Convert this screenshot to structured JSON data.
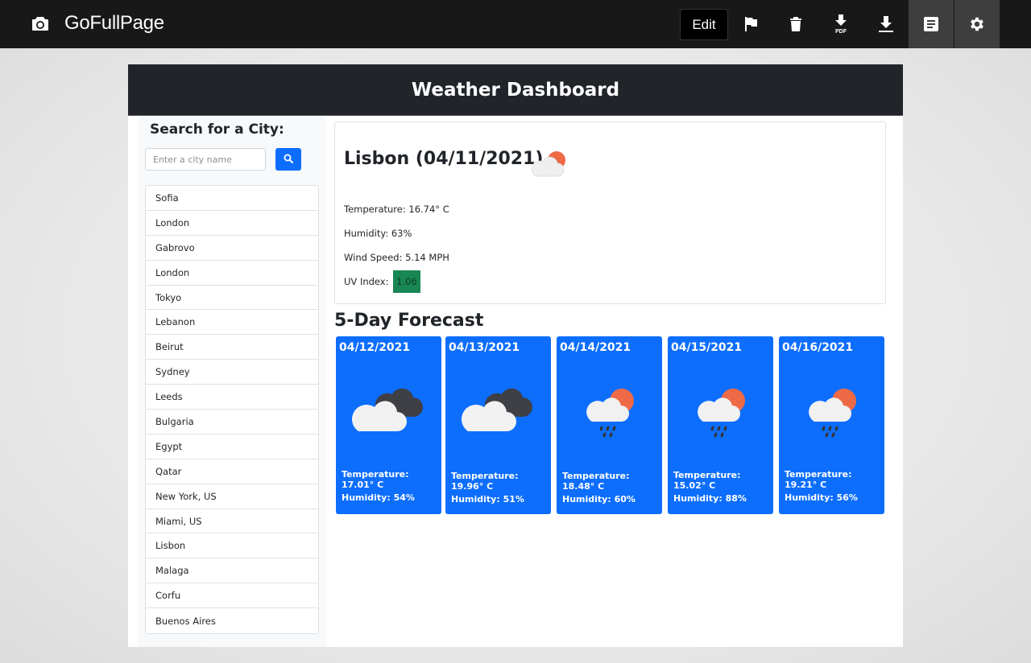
{
  "extension": {
    "title": "GoFullPage",
    "edit_label": "Edit",
    "icons": [
      "camera-icon",
      "flag-icon",
      "trash-icon",
      "download-pdf-icon",
      "download-icon",
      "document-icon",
      "gear-icon"
    ],
    "pdf_badge": "PDF"
  },
  "app": {
    "title": "Weather Dashboard",
    "search": {
      "heading": "Search for a City:",
      "placeholder": "Enter a city name",
      "value": ""
    },
    "history": [
      "Sofia",
      "London",
      "Gabrovo",
      "London",
      "Tokyo",
      "Lebanon",
      "Beirut",
      "Sydney",
      "Leeds",
      "Bulgaria",
      "Egypt",
      "Qatar",
      "New York, US",
      "Miami, US",
      "Lisbon",
      "Malaga",
      "Corfu",
      "Buenos Aires"
    ],
    "current": {
      "heading": "Lisbon (04/11/2021)",
      "icon": "cloud-sun-icon",
      "temperature": "Temperature: 16.74° C",
      "humidity": "Humidity: 63%",
      "wind": "Wind Speed: 5.14 MPH",
      "uv_label": "UV Index:",
      "uv_value": "1.06",
      "uv_color": "#198754"
    },
    "forecast_title": "5-Day Forecast",
    "forecast": [
      {
        "date": "04/12/2021",
        "icon": "cloudy-icon",
        "temp": "Temperature: 17.01° C",
        "humidity": "Humidity: 54%"
      },
      {
        "date": "04/13/2021",
        "icon": "cloudy-icon",
        "temp": "Temperature: 19.96° C",
        "humidity": "Humidity: 51%"
      },
      {
        "date": "04/14/2021",
        "icon": "rain-sun-icon",
        "temp": "Temperature: 18.48° C",
        "humidity": "Humidity: 60%"
      },
      {
        "date": "04/15/2021",
        "icon": "rain-sun-icon",
        "temp": "Temperature: 15.02° C",
        "humidity": "Humidity: 88%"
      },
      {
        "date": "04/16/2021",
        "icon": "rain-sun-icon",
        "temp": "Temperature: 19.21° C",
        "humidity": "Humidity: 56%"
      }
    ],
    "colors": {
      "header_bg": "#212529",
      "primary": "#0d6efd",
      "sun": "#ee6a46",
      "cloud": "#f1f1f1",
      "dark_cloud": "#3f3f46"
    }
  }
}
